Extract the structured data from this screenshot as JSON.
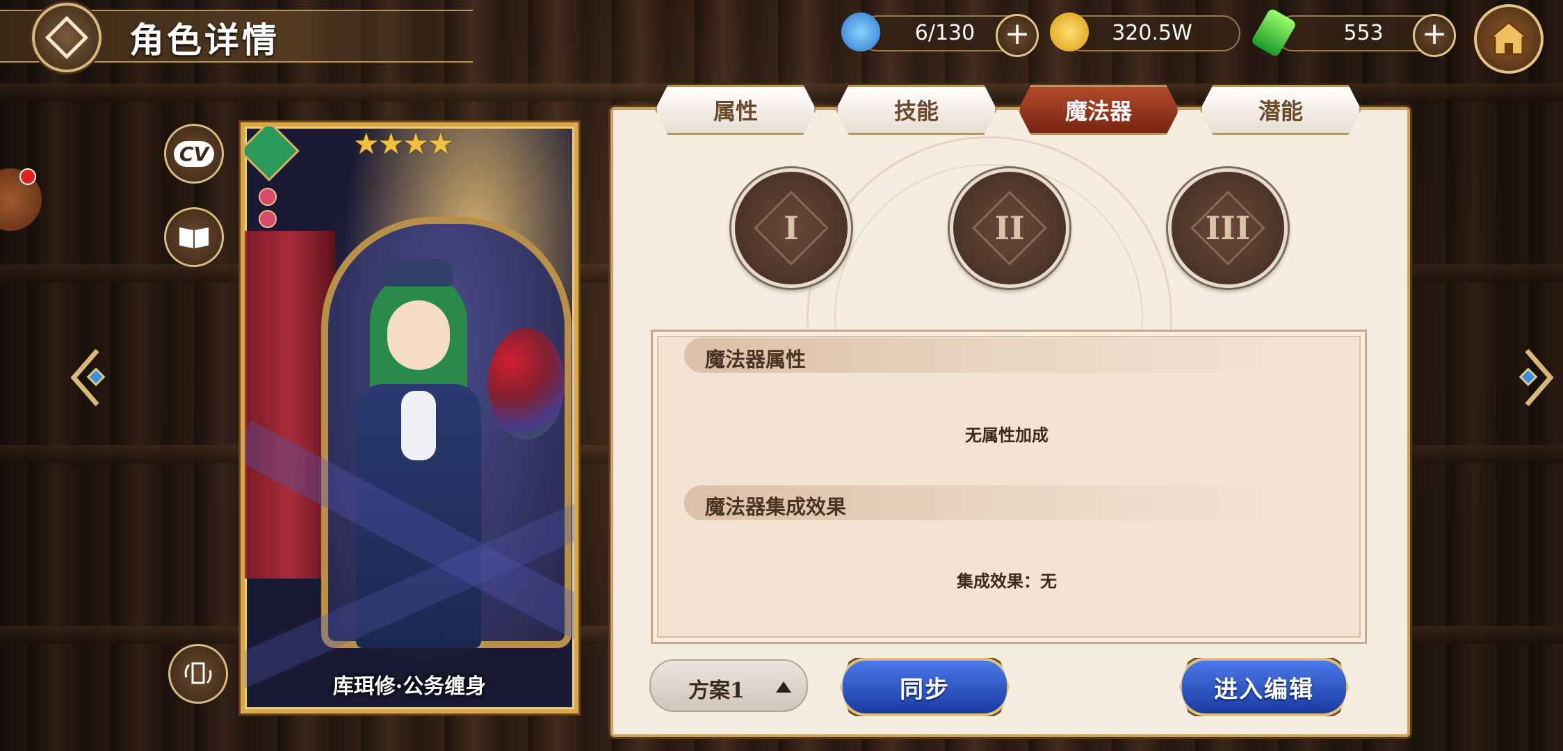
{
  "header": {
    "title": "角色详情",
    "back_icon": "diamond-back-icon",
    "home_icon": "home-icon"
  },
  "resources": [
    {
      "name": "stamina",
      "icon": "blue-fish-icon",
      "value": "6/130",
      "color": "#3aa0e0"
    },
    {
      "name": "gold",
      "icon": "gold-coin-icon",
      "value": "320.5W",
      "color": "#e8b020"
    },
    {
      "name": "gem",
      "icon": "green-crystal-icon",
      "value": "553",
      "color": "#40c040"
    }
  ],
  "side_buttons": {
    "cv_label": "CV",
    "book_icon": "book-icon",
    "rotate_icon": "rotate-card-icon"
  },
  "character": {
    "name": "库珥修·公务缠身",
    "stars": "★★★★",
    "star_count": 4,
    "element_icon": "wind-element-icon"
  },
  "tabs": [
    {
      "label": "属性",
      "active": false
    },
    {
      "label": "技能",
      "active": false
    },
    {
      "label": "魔法器",
      "active": true
    },
    {
      "label": "潜能",
      "active": false
    }
  ],
  "slots": [
    "I",
    "II",
    "III"
  ],
  "magic_attr": {
    "heading": "魔法器属性",
    "body": "无属性加成"
  },
  "set_effect": {
    "heading": "魔法器集成效果",
    "body": "集成效果：无"
  },
  "footer": {
    "plan_label": "方案1",
    "sync_label": "同步",
    "edit_label": "进入编辑"
  },
  "colors": {
    "accent_gold": "#d8a84a",
    "active_tab": "#9a3a1e",
    "button_blue": "#2a52c8"
  }
}
